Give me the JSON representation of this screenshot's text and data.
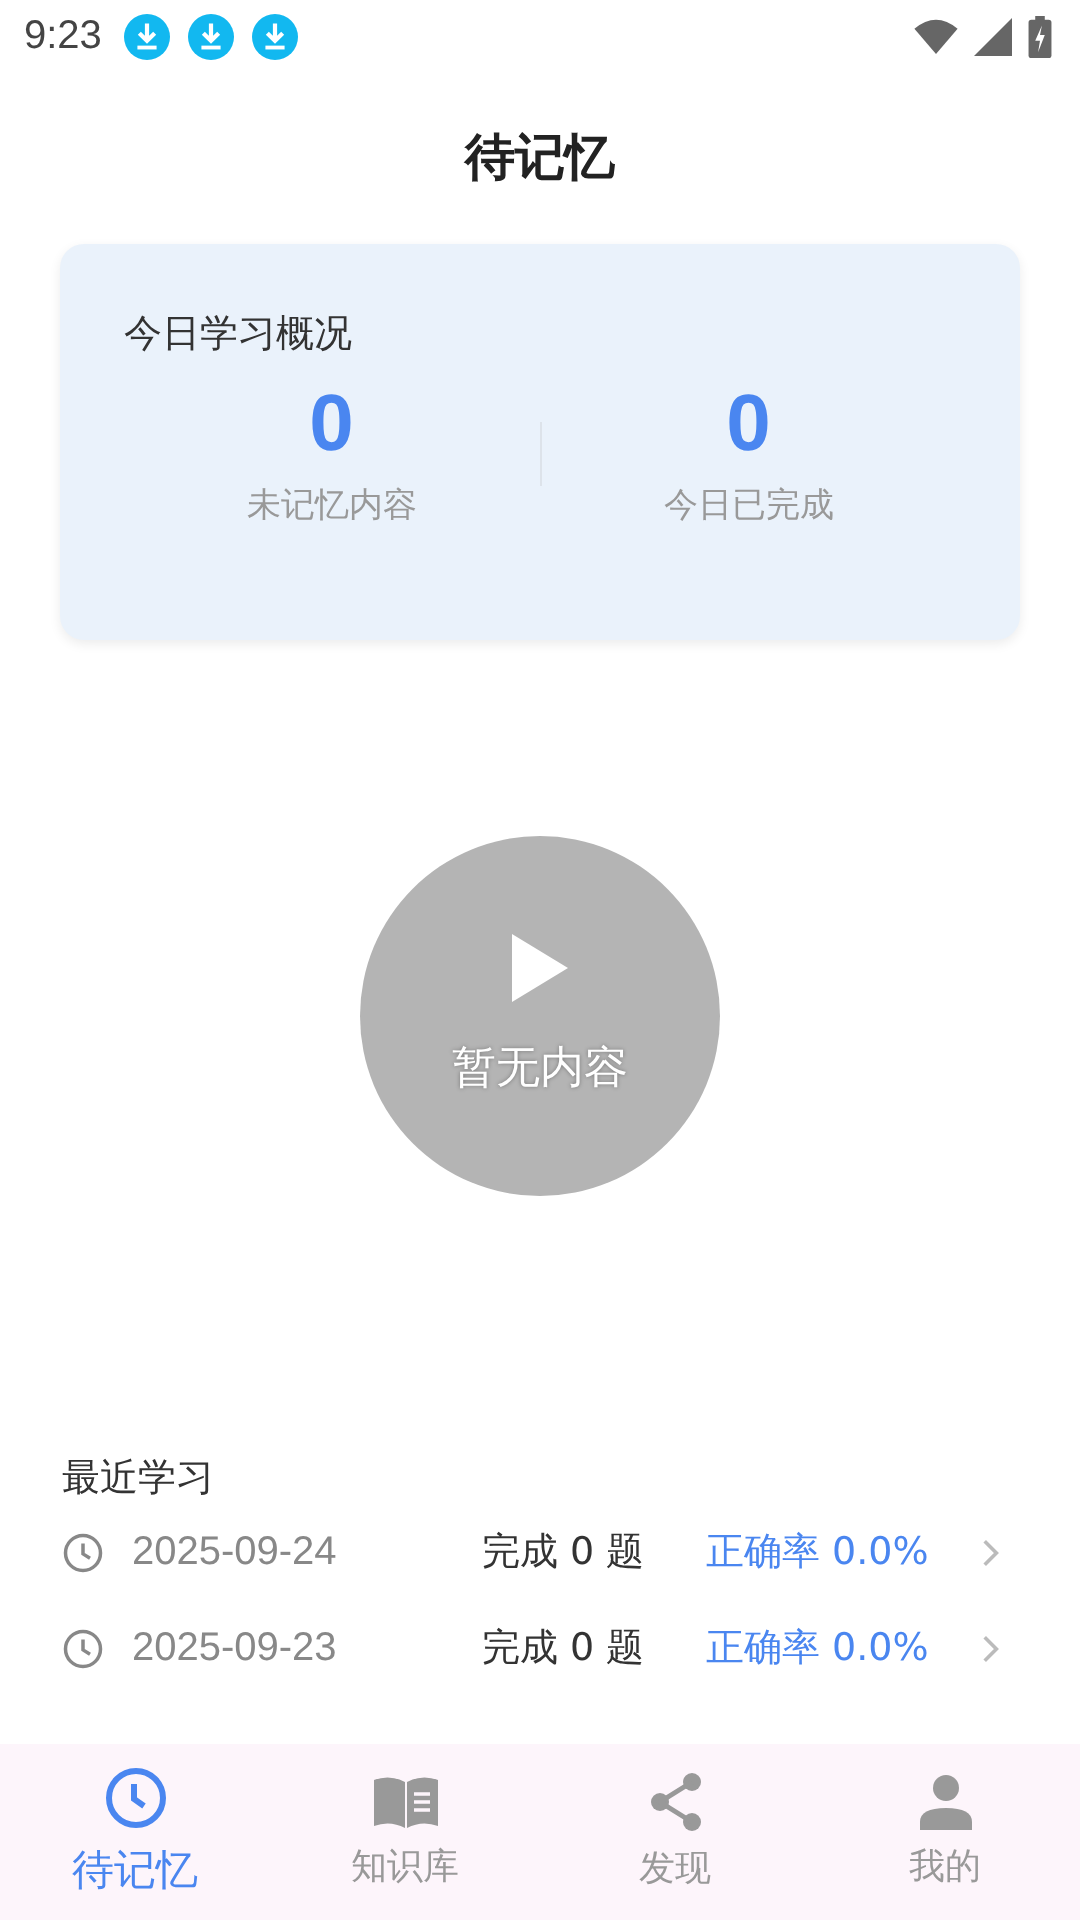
{
  "status_bar": {
    "time": "9:23",
    "notifications": [
      {
        "kind": "download"
      },
      {
        "kind": "download"
      },
      {
        "kind": "download"
      }
    ]
  },
  "title": "待记忆",
  "summary": {
    "title": "今日学习概况",
    "stats": [
      {
        "value": "0",
        "label": "未记忆内容"
      },
      {
        "value": "0",
        "label": "今日已完成"
      }
    ]
  },
  "play": {
    "label": "暂无内容",
    "disabled": true
  },
  "recent": {
    "title": "最近学习",
    "rows": [
      {
        "date": "2025-09-24",
        "done": "完成 0 题",
        "accuracy": "正确率 0.0%"
      },
      {
        "date": "2025-09-23",
        "done": "完成 0 题",
        "accuracy": "正确率 0.0%"
      }
    ]
  },
  "tabs": [
    {
      "label": "待记忆",
      "selected": true
    },
    {
      "label": "知识库",
      "selected": false
    },
    {
      "label": "发现",
      "selected": false
    },
    {
      "label": "我的",
      "selected": false
    }
  ]
}
